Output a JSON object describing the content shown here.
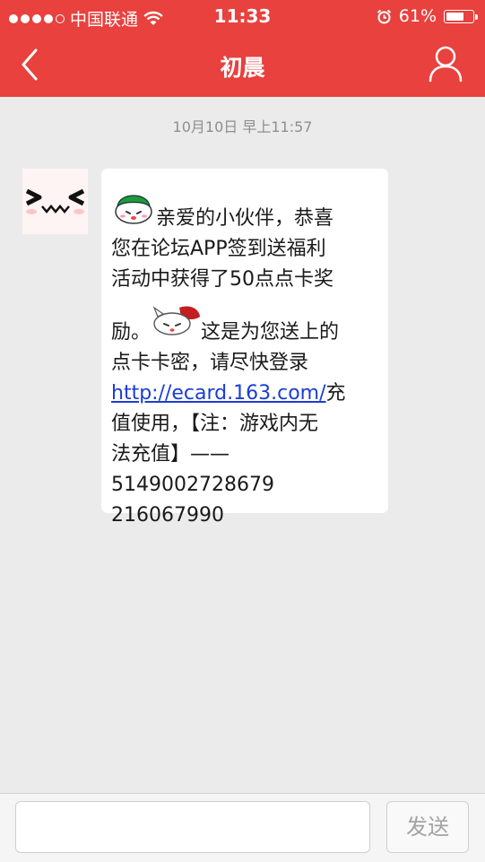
{
  "status_bar": {
    "carrier": "中国联通",
    "time": "11:33",
    "battery_pct": "61%",
    "battery_level": 0.61
  },
  "nav": {
    "title": "初晨",
    "back_icon": "chevron-left-icon",
    "profile_icon": "user-icon"
  },
  "chat": {
    "timestamp": "10月10日 早上11:57",
    "message": {
      "line1": "亲爱的小伙伴，恭喜",
      "line2": "您在论坛APP签到送福利",
      "line3": "活动中获得了50点点卡奖",
      "line4a": "励。",
      "line4b": "这是为您送上的",
      "line5": "点卡卡密，请尽快登录",
      "link": "http://ecard.163.com/",
      "line6b": "充",
      "line7": "值使用，【注：游戏内无",
      "line8": "法充值】——",
      "line9": "5149002728679",
      "line10": "216067990"
    }
  },
  "input_bar": {
    "placeholder": "",
    "send_label": "发送"
  },
  "colors": {
    "header": "#e8413e",
    "background": "#ebebeb",
    "link": "#1a3cd6"
  }
}
